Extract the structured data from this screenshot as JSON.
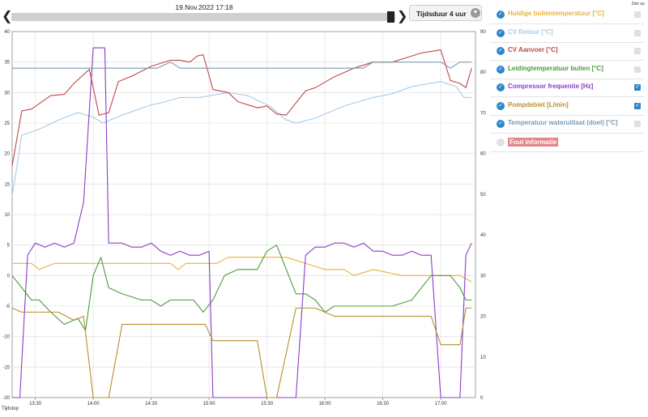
{
  "header": {
    "datetime": "19.Nov.2022 17:18",
    "duration_label": "Tijdsduur 4 uur"
  },
  "legend": {
    "header": "2de as",
    "items": [
      {
        "label": "Huidige buitentemperatuur [°C]",
        "color": "#e8b33c",
        "checked": true,
        "second_axis": false
      },
      {
        "label": "CV Retour [°C]",
        "color": "#a8cce8",
        "checked": true,
        "second_axis": false
      },
      {
        "label": "CV Aanvoer [°C]",
        "color": "#c04848",
        "checked": true,
        "second_axis": false
      },
      {
        "label": "Leidingtemperatuur buiten [°C]",
        "color": "#4a9c3c",
        "checked": true,
        "second_axis": false
      },
      {
        "label": "Compressor frequentie [Hz]",
        "color": "#8c3cc8",
        "checked": true,
        "second_axis": true
      },
      {
        "label": "Pompdebiet [L/min]",
        "color": "#b4902e",
        "checked": true,
        "second_axis": true
      },
      {
        "label": "Temperatuur wateruitlaat (doel) [°C]",
        "color": "#7a9ab4",
        "checked": true,
        "second_axis": false
      },
      {
        "label": "Fout informatie",
        "color": "#e3868a",
        "checked": false,
        "second_axis": false
      }
    ]
  },
  "chart_data": {
    "type": "line",
    "xlabel": "Tijdstop",
    "x_ticks": [
      "13:30",
      "14:00",
      "14:30",
      "15:00",
      "15:30",
      "16:00",
      "16:30",
      "17:00"
    ],
    "x_tick_minutes": [
      810,
      840,
      870,
      900,
      930,
      960,
      990,
      1020
    ],
    "xlim": [
      798,
      1038
    ],
    "ylim": [
      -20,
      40
    ],
    "yticks": [
      -20,
      -15,
      -10,
      -5,
      0,
      5,
      10,
      15,
      20,
      25,
      30,
      35,
      40
    ],
    "y2lim": [
      0,
      90
    ],
    "y2ticks": [
      0,
      10,
      20,
      30,
      40,
      50,
      60,
      70,
      80,
      90
    ],
    "grid": true,
    "series": [
      {
        "name": "Huidige buitentemperatuur [°C]",
        "axis": "left",
        "color": "#e8b33c",
        "x": [
          798,
          808,
          812,
          820,
          840,
          880,
          884,
          888,
          898,
          904,
          910,
          940,
          950,
          960,
          970,
          975,
          985,
          1000,
          1020,
          1030,
          1036
        ],
        "values": [
          2,
          2,
          1,
          2,
          2,
          2,
          1,
          2,
          2,
          2,
          3,
          3,
          2,
          1,
          1,
          0,
          1,
          0,
          0,
          0,
          -1
        ]
      },
      {
        "name": "CV Retour [°C]",
        "axis": "left",
        "color": "#a8cce8",
        "x": [
          798,
          803,
          812,
          822,
          832,
          840,
          845,
          855,
          870,
          875,
          885,
          895,
          910,
          920,
          932,
          937,
          940,
          945,
          955,
          970,
          985,
          995,
          1005,
          1020,
          1028,
          1032,
          1036
        ],
        "values": [
          13,
          23,
          24,
          25.5,
          26.7,
          26,
          25,
          26.3,
          28,
          28.3,
          29.2,
          29.2,
          30,
          29.5,
          27.7,
          26.3,
          25.5,
          25,
          25.8,
          27.8,
          29.2,
          29.8,
          31,
          31.8,
          31,
          29.2,
          29.2
        ]
      },
      {
        "name": "CV Aanvoer [°C]",
        "axis": "left",
        "color": "#c04848",
        "x": [
          798,
          803,
          808,
          818,
          825,
          830,
          838,
          843,
          848,
          853,
          860,
          870,
          880,
          885,
          890,
          894,
          897,
          902,
          910,
          915,
          925,
          930,
          935,
          940,
          950,
          955,
          965,
          975,
          985,
          995,
          1010,
          1020,
          1025,
          1030,
          1033,
          1036
        ],
        "values": [
          18,
          27,
          27.3,
          29.5,
          29.7,
          31.5,
          33.8,
          26.3,
          26.7,
          31.8,
          32.7,
          34.3,
          35.3,
          35.3,
          35,
          36,
          36.2,
          30.5,
          30,
          28.5,
          27.5,
          27.8,
          26.5,
          26.3,
          30.3,
          30.8,
          32.6,
          34,
          35,
          35,
          36.5,
          37,
          32,
          31.5,
          30.8,
          34
        ]
      },
      {
        "name": "Leidingtemperatuur buiten [°C]",
        "axis": "left",
        "color": "#4a9c3c",
        "x": [
          798,
          803,
          808,
          812,
          818,
          825,
          832,
          836,
          840,
          844,
          848,
          855,
          865,
          870,
          875,
          880,
          887,
          892,
          897,
          902,
          908,
          915,
          920,
          925,
          930,
          935,
          945,
          950,
          955,
          960,
          965,
          970,
          980,
          990,
          995,
          1005,
          1015,
          1025,
          1030,
          1033,
          1036
        ],
        "values": [
          0,
          -2,
          -4,
          -4,
          -6,
          -8,
          -7,
          -9,
          0,
          3,
          -2,
          -3,
          -4,
          -4,
          -5,
          -4,
          -4,
          -4,
          -6,
          -4,
          0,
          1,
          1,
          1,
          4,
          5,
          -3,
          -3,
          -4,
          -6,
          -5,
          -5,
          -5,
          -5,
          -5,
          -4,
          0,
          0,
          -2,
          -4,
          -4
        ]
      },
      {
        "name": "Compressor frequentie [Hz]",
        "axis": "right",
        "color": "#8c3cc8",
        "x": [
          798,
          802,
          806,
          810,
          815,
          820,
          825,
          830,
          835,
          840,
          843,
          846,
          848,
          855,
          860,
          865,
          870,
          875,
          880,
          885,
          890,
          895,
          900,
          902,
          910,
          920,
          930,
          935,
          940,
          945,
          950,
          955,
          960,
          965,
          970,
          975,
          980,
          985,
          990,
          995,
          1000,
          1005,
          1010,
          1015,
          1020,
          1025,
          1030,
          1033,
          1036
        ],
        "values": [
          0,
          0,
          35,
          38,
          37,
          38,
          37,
          38,
          48,
          86,
          86,
          86,
          38,
          38,
          37,
          37,
          38,
          36,
          35,
          36,
          35,
          35,
          36,
          0,
          0,
          0,
          0,
          0,
          0,
          0,
          35,
          37,
          37,
          38,
          38,
          37,
          38,
          36,
          36,
          35,
          35,
          36,
          35,
          35,
          0,
          0,
          0,
          35,
          38
        ]
      },
      {
        "name": "Pompdebiet [L/min]",
        "axis": "right",
        "color": "#b4902e",
        "x": [
          798,
          803,
          812,
          822,
          830,
          835,
          840,
          844,
          848,
          855,
          860,
          865,
          870,
          875,
          880,
          885,
          890,
          895,
          898,
          902,
          910,
          920,
          925,
          930,
          935,
          945,
          950,
          955,
          960,
          965,
          970,
          980,
          985,
          995,
          1000,
          1005,
          1010,
          1015,
          1020,
          1025,
          1030,
          1033,
          1036
        ],
        "values": [
          22,
          21,
          21,
          21,
          19,
          20,
          0,
          0,
          0,
          18,
          18,
          18,
          18,
          18,
          18,
          18,
          18,
          18,
          18,
          14,
          14,
          14,
          14,
          0,
          0,
          22,
          22,
          22,
          21,
          20,
          20,
          20,
          20,
          20,
          20,
          20,
          20,
          20,
          13,
          13,
          13,
          22,
          22
        ]
      },
      {
        "name": "Temperatuur wateruitlaat (doel) [°C]",
        "axis": "left",
        "color": "#7a9ab4",
        "x": [
          798,
          868,
          873,
          880,
          885,
          890,
          895,
          900,
          910,
          940,
          970,
          980,
          985,
          990,
          1005,
          1020,
          1025,
          1030,
          1036
        ],
        "values": [
          34,
          34,
          34,
          35,
          34,
          34,
          34,
          34,
          34,
          34,
          34,
          34,
          35,
          35,
          35,
          35,
          34,
          35,
          35
        ]
      }
    ]
  }
}
